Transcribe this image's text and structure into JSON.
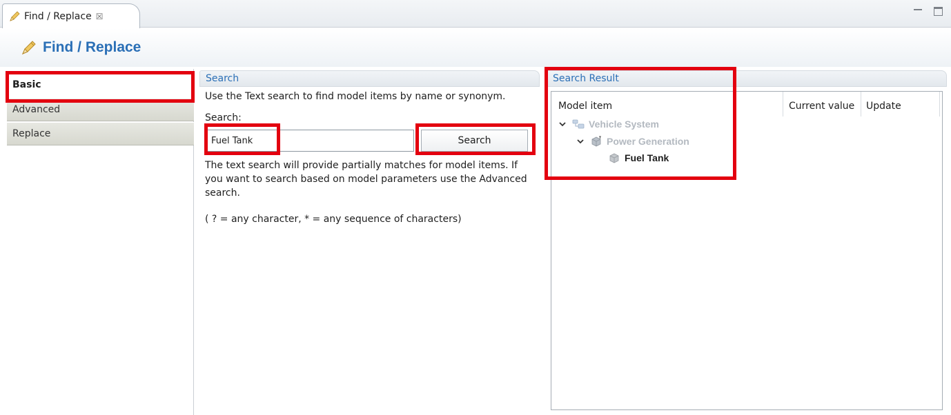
{
  "tab": {
    "title": "Find / Replace",
    "close_glyph": "☒",
    "icon": "pencil-icon"
  },
  "window_controls": {
    "minimize_icon": "minimize-icon",
    "maximize_icon": "maximize-icon"
  },
  "header": {
    "title": "Find / Replace",
    "icon": "pencil-icon"
  },
  "nav": {
    "items": [
      {
        "label": "Basic",
        "active": true
      },
      {
        "label": "Advanced",
        "active": false
      },
      {
        "label": "Replace",
        "active": false
      }
    ]
  },
  "search": {
    "section_title": "Search",
    "description": "Use the Text search to find model items by name or synonym.",
    "field_label": "Search:",
    "input_value": "Fuel Tank",
    "button_label": "Search",
    "help_text": "The text search will provide partially matches for model items. If you want to search based on model parameters use the Advanced search.",
    "wildcard_text": "( ? = any character, * = any sequence of characters)"
  },
  "result": {
    "section_title": "Search Result",
    "columns": [
      "Model item",
      "Current value",
      "Update"
    ],
    "tree": [
      {
        "label": "Vehicle System",
        "icon": "system-icon",
        "dimmed": true
      },
      {
        "label": "Power Generation",
        "icon": "component-icon",
        "dimmed": true
      },
      {
        "label": "Fuel Tank",
        "icon": "part-icon",
        "dimmed": false
      }
    ]
  },
  "colors": {
    "accent": "#2a6fb6",
    "highlight": "#e3000f",
    "dimmed_text": "#b3b9c0"
  }
}
